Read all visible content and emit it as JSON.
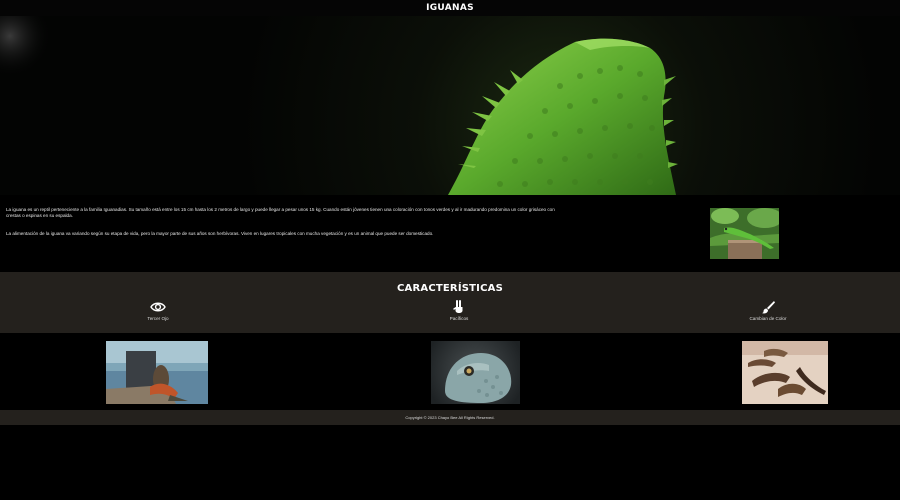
{
  "header": {
    "title": "IGUANAS"
  },
  "hero": {
    "image": "green-iguana-photo"
  },
  "intro": {
    "paragraphs": [
      "La iguana es un reptil perteneciente a la familia Iguanadias. Su tamaño está entre los 15 cm hasta los 2 metros de largo y puede llegar a pesar unos 15 kg. Cuando están jóvenes tienen una coloración con tonos verdes y al ir madurando predomina un color grisáceo con crestas o espinas en su espalda.",
      "La alimentación de la iguana va variando según su etapa de vida, pero la mayor parte de sus años son herbívoras. Viven en lugares tropicales con mucha vegetación y es un animal que puede ser domesticado."
    ],
    "thumbnail": "iguana-on-wood-photo"
  },
  "features": {
    "title": "CARACTERÍSTICAS",
    "items": [
      {
        "label": "Tercer Ojo",
        "icon": "eye-icon"
      },
      {
        "label": "Pacíficos",
        "icon": "peace-hand-icon"
      },
      {
        "label": "Cambian de Color",
        "icon": "paint-brush-icon"
      }
    ]
  },
  "gallery": {
    "images": [
      "person-holding-iguana-photo",
      "iguana-head-photo",
      "iguanas-on-sand-photo"
    ]
  },
  "footer": {
    "copyright": "Copyright © 2023 Chayo Bee All Rights Reserved."
  },
  "colors": {
    "dark_band": "#24211d",
    "background": "#000000",
    "hero_green": "#5fa832"
  }
}
